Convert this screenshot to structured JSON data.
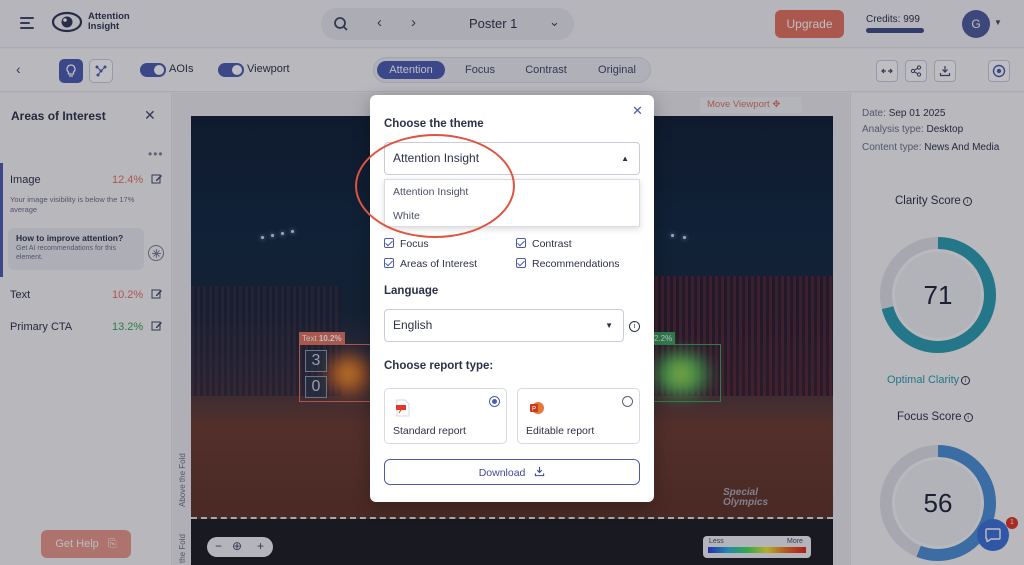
{
  "app": {
    "logo_text": "Attention\nInsight",
    "project_title": "Poster 1",
    "upgrade_label": "Upgrade",
    "credits_label": "Credits: 999",
    "avatar_initial": "G"
  },
  "toolbar": {
    "aois_label": "AOIs",
    "viewport_label": "Viewport",
    "tabs": [
      {
        "label": "Attention",
        "active": true
      },
      {
        "label": "Focus",
        "active": false
      },
      {
        "label": "Contrast",
        "active": false
      },
      {
        "label": "Original",
        "active": false
      }
    ]
  },
  "left_panel": {
    "title": "Areas of Interest",
    "items": [
      {
        "name": "Image",
        "pct": "12.4%",
        "pct_color": "#e4725f",
        "note": "Your image visibility is below the 17% average"
      },
      {
        "name": "Text",
        "pct": "10.2%",
        "pct_color": "#e4725f"
      },
      {
        "name": "Primary CTA",
        "pct": "13.2%",
        "pct_color": "#3aa35a"
      }
    ],
    "tip_title": "How to improve attention?",
    "tip_desc": "Get AI recommendations for this element.",
    "help_label": "Get Help"
  },
  "canvas": {
    "move_viewport": "Move Viewport",
    "above_fold": "Above the Fold",
    "below_fold": "the Fold",
    "aoi_text_tag": "Text",
    "aoi_text_pct": "10.2%",
    "aoi_right_pct": "2.2%",
    "digits": [
      "3",
      "0"
    ],
    "watermark_1": "Special",
    "watermark_2": "Olympics",
    "legend_less": "Less",
    "legend_more": "More"
  },
  "right_panel": {
    "date_label": "Date:",
    "date_value": "Sep 01 2025",
    "analysis_label": "Analysis type:",
    "analysis_value": "Desktop",
    "content_label": "Content type:",
    "content_value": "News And Media",
    "clarity_title": "Clarity Score",
    "clarity_value": "71",
    "clarity_fraction": 0.71,
    "clarity_status": "Optimal Clarity",
    "focus_title": "Focus Score",
    "focus_value": "56",
    "focus_fraction": 0.56,
    "chat_badge": "1"
  },
  "modal": {
    "theme_label": "Choose the theme",
    "theme_selected": "Attention Insight",
    "theme_options": [
      "Attention Insight",
      "White"
    ],
    "checkboxes": [
      {
        "label": "Focus",
        "checked": true
      },
      {
        "label": "Contrast",
        "checked": true
      },
      {
        "label": "Areas of Interest",
        "checked": true
      },
      {
        "label": "Recommendations",
        "checked": true
      }
    ],
    "language_label": "Language",
    "language_selected": "English",
    "report_type_label": "Choose report type:",
    "report_types": [
      {
        "label": "Standard report",
        "selected": true
      },
      {
        "label": "Editable report",
        "selected": false
      }
    ],
    "download_label": "Download"
  },
  "colors": {
    "accent": "#4a5bb0",
    "upgrade": "#e3715f",
    "highlight": "#e0533f",
    "clarity_gauge": "#2a9bb0",
    "focus_gauge": "#4a8fd6"
  }
}
